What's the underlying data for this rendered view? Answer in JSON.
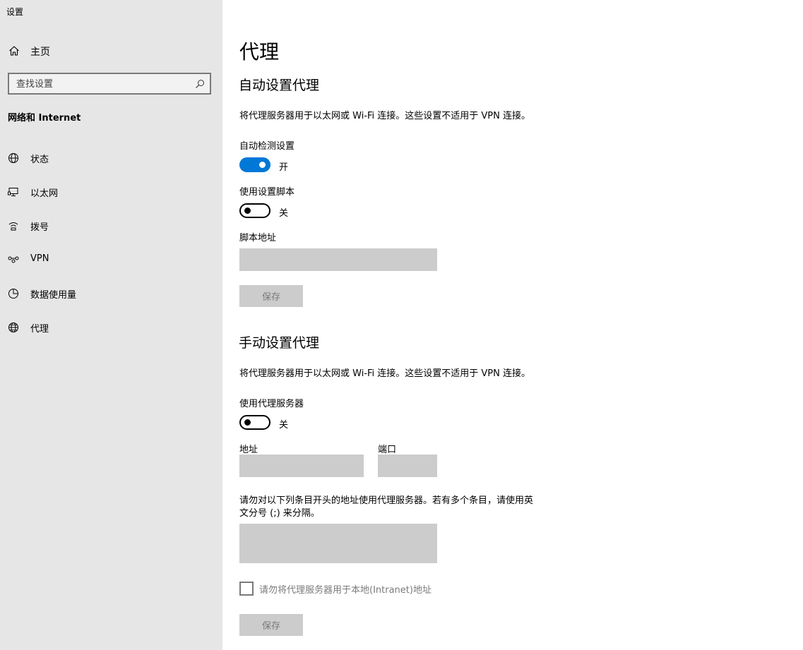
{
  "app": {
    "title": "设置"
  },
  "sidebar": {
    "home_label": "主页",
    "search_placeholder": "查找设置",
    "section_title": "网络和 Internet",
    "items": [
      {
        "label": "状态",
        "icon": "globe-status-icon"
      },
      {
        "label": "以太网",
        "icon": "ethernet-icon"
      },
      {
        "label": "拨号",
        "icon": "dialup-icon"
      },
      {
        "label": "VPN",
        "icon": "vpn-icon"
      },
      {
        "label": "数据使用量",
        "icon": "data-usage-icon"
      },
      {
        "label": "代理",
        "icon": "proxy-globe-icon"
      }
    ]
  },
  "main": {
    "title": "代理",
    "auto": {
      "heading": "自动设置代理",
      "description": "将代理服务器用于以太网或 Wi-Fi 连接。这些设置不适用于 VPN 连接。",
      "detect_label": "自动检测设置",
      "detect_state": "开",
      "script_label": "使用设置脚本",
      "script_state": "关",
      "address_label": "脚本地址",
      "save_label": "保存"
    },
    "manual": {
      "heading": "手动设置代理",
      "description": "将代理服务器用于以太网或 Wi-Fi 连接。这些设置不适用于 VPN 连接。",
      "proxy_label": "使用代理服务器",
      "proxy_state": "关",
      "address_label": "地址",
      "port_label": "端口",
      "exceptions_line1": "请勿对以下列条目开头的地址使用代理服务器。若有多个条目，请使用英",
      "exceptions_line2": "文分号 (;) 来分隔。",
      "local_checkbox_label": "请勿将代理服务器用于本地(Intranet)地址",
      "save_label": "保存"
    }
  },
  "colors": {
    "accent": "#0078d7",
    "sidebar_bg": "#e6e6e6",
    "disabled_field": "#cccccc",
    "disabled_text": "#7a7a7a"
  }
}
